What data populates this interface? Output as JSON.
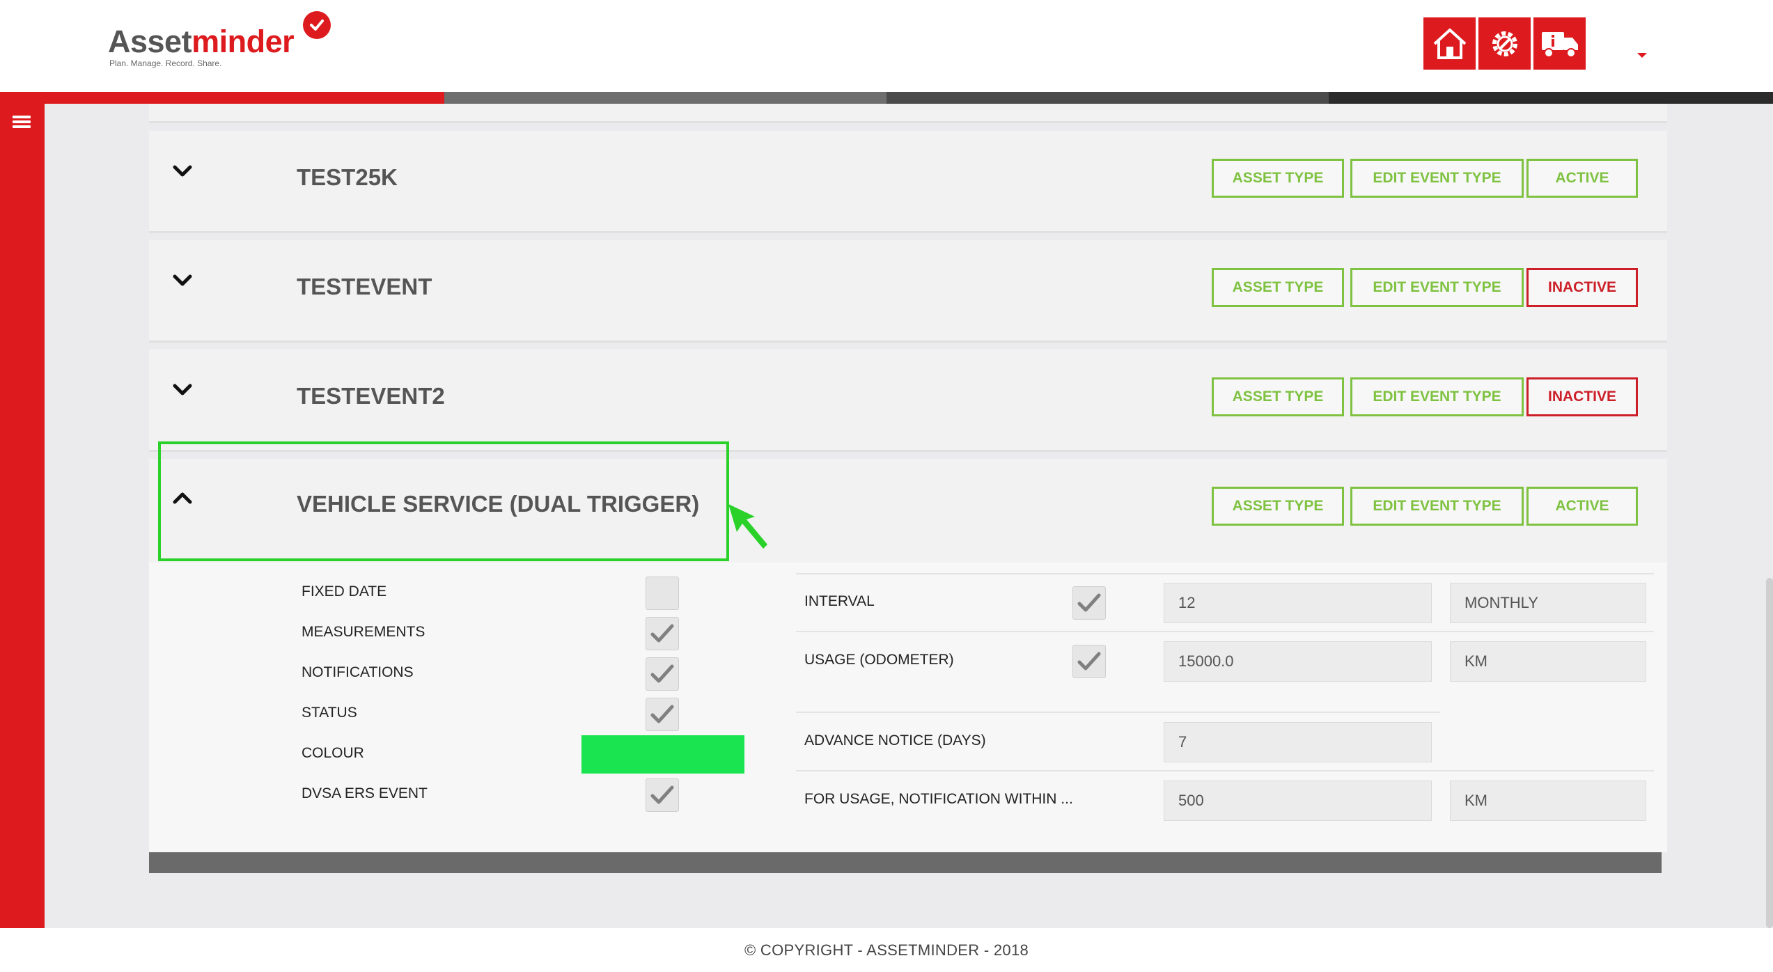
{
  "app": {
    "brand_part1": "Asset",
    "brand_part2": "minder",
    "tagline": "Plan. Manage. Record. Share."
  },
  "header": {
    "buttons": [
      {
        "icon": "home-icon"
      },
      {
        "icon": "gear-wrench-icon"
      },
      {
        "icon": "truck-info-icon"
      }
    ],
    "accent_color": "#dd1a1e"
  },
  "events": [
    {
      "name": "TEST25K",
      "expanded": false,
      "asset_type_label": "ASSET TYPE",
      "edit_label": "EDIT EVENT TYPE",
      "status_label": "ACTIVE"
    },
    {
      "name": "TESTEVENT",
      "expanded": false,
      "asset_type_label": "ASSET TYPE",
      "edit_label": "EDIT EVENT TYPE",
      "status_label": "INACTIVE"
    },
    {
      "name": "TESTEVENT2",
      "expanded": false,
      "asset_type_label": "ASSET TYPE",
      "edit_label": "EDIT EVENT TYPE",
      "status_label": "INACTIVE"
    },
    {
      "name": "VEHICLE SERVICE (DUAL TRIGGER)",
      "expanded": true,
      "asset_type_label": "ASSET TYPE",
      "edit_label": "EDIT EVENT TYPE",
      "status_label": "ACTIVE"
    }
  ],
  "details": {
    "flags": [
      {
        "label": "FIXED DATE",
        "checked": false
      },
      {
        "label": "MEASUREMENTS",
        "checked": true
      },
      {
        "label": "NOTIFICATIONS",
        "checked": true
      },
      {
        "label": "STATUS",
        "checked": true
      },
      {
        "label": "COLOUR",
        "color": "#1ae44f"
      },
      {
        "label": "DVSA ERS EVENT",
        "checked": true
      }
    ],
    "triggers": {
      "interval": {
        "label": "INTERVAL",
        "checked": true,
        "value": "12",
        "unit": "MONTHLY"
      },
      "usage": {
        "label": "USAGE (ODOMETER)",
        "checked": true,
        "value": "15000.0",
        "unit": "KM"
      },
      "advance_notice": {
        "label": "ADVANCE NOTICE (DAYS)",
        "value": "7"
      },
      "usage_notification": {
        "label": "FOR USAGE, NOTIFICATION WITHIN ...",
        "value": "500",
        "unit": "KM"
      }
    }
  },
  "footer": {
    "text": "© COPYRIGHT - ASSETMINDER - 2018"
  },
  "colors": {
    "active_green": "#7fc241",
    "inactive_red": "#cc1f28",
    "highlight_green": "#29d129"
  }
}
